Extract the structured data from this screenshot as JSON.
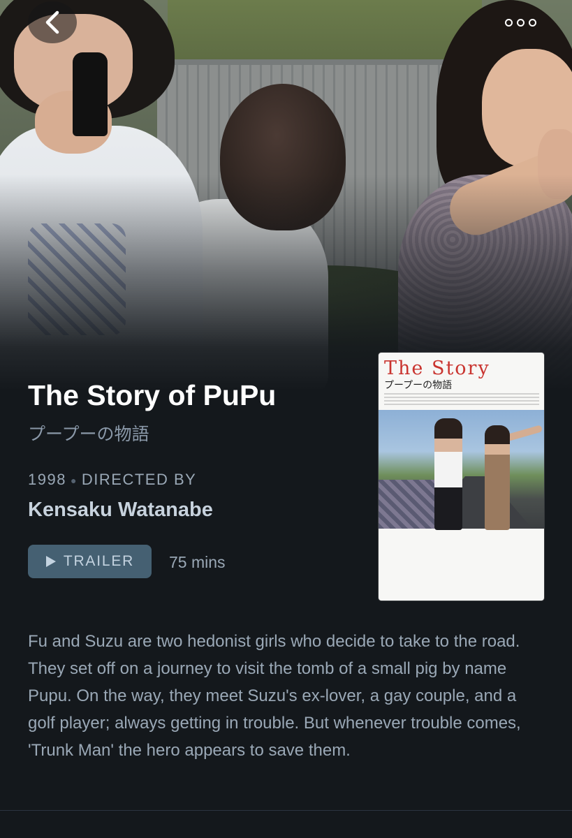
{
  "nav": {
    "back_icon": "chevron-left-icon",
    "more_icon": "more-options-icon"
  },
  "film": {
    "title": "The Story of PuPu",
    "original_title": "プープーの物語",
    "year": "1998",
    "directed_by_label": "DIRECTED BY",
    "director": "Kensaku Watanabe",
    "trailer_label": "TRAILER",
    "runtime": "75 mins",
    "description": "Fu and Suzu are two hedonist girls who decide to take to the road. They set off on a journey to visit the tomb of a small pig by name Pupu. On the way, they meet Suzu's ex-lover, a gay couple, and a golf player; always getting in trouble. But whenever trouble comes, 'Trunk Man' the hero appears to save them."
  },
  "poster": {
    "title_text": "The Story",
    "subtitle_text": "プープーの物語"
  },
  "colors": {
    "background": "#14181c",
    "accent_button": "#456072",
    "muted_text": "#9aa8b6",
    "poster_red": "#c9342f"
  }
}
